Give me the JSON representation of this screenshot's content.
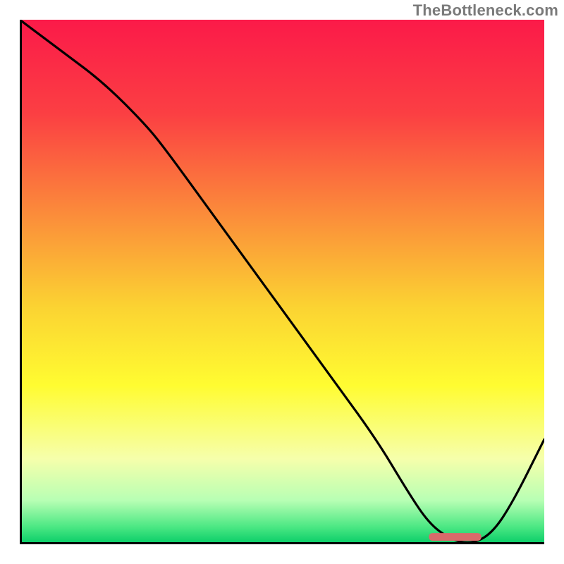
{
  "watermark": "TheBottleneck.com",
  "chart_data": {
    "type": "line",
    "title": "",
    "xlabel": "",
    "ylabel": "",
    "xlim": [
      0,
      100
    ],
    "ylim": [
      0,
      100
    ],
    "series": [
      {
        "name": "bottleneck-curve",
        "x": [
          0,
          8,
          16,
          24,
          28,
          36,
          44,
          52,
          60,
          68,
          74,
          78,
          82,
          86,
          90,
          94,
          100
        ],
        "values": [
          100,
          94,
          88,
          80,
          75,
          64,
          53,
          42,
          31,
          20,
          10,
          4,
          1,
          0,
          2,
          8,
          20
        ]
      }
    ],
    "marker": {
      "name": "optimal-range",
      "x_start": 78,
      "x_end": 88,
      "y": 1.4,
      "color": "#d96a6a"
    },
    "background": {
      "type": "vertical-gradient",
      "stops": [
        {
          "pos": 0.0,
          "color": "#fb1a49"
        },
        {
          "pos": 0.18,
          "color": "#fb3f43"
        },
        {
          "pos": 0.38,
          "color": "#fb8f3a"
        },
        {
          "pos": 0.55,
          "color": "#fbd332"
        },
        {
          "pos": 0.7,
          "color": "#fffc31"
        },
        {
          "pos": 0.84,
          "color": "#f6ffab"
        },
        {
          "pos": 0.92,
          "color": "#b8ffb4"
        },
        {
          "pos": 0.97,
          "color": "#4de884"
        },
        {
          "pos": 1.0,
          "color": "#0ecf6a"
        }
      ]
    },
    "axes": {
      "color": "#000000",
      "thickness": 6
    },
    "line_style": {
      "color": "#000000",
      "thickness": 3.2
    }
  }
}
